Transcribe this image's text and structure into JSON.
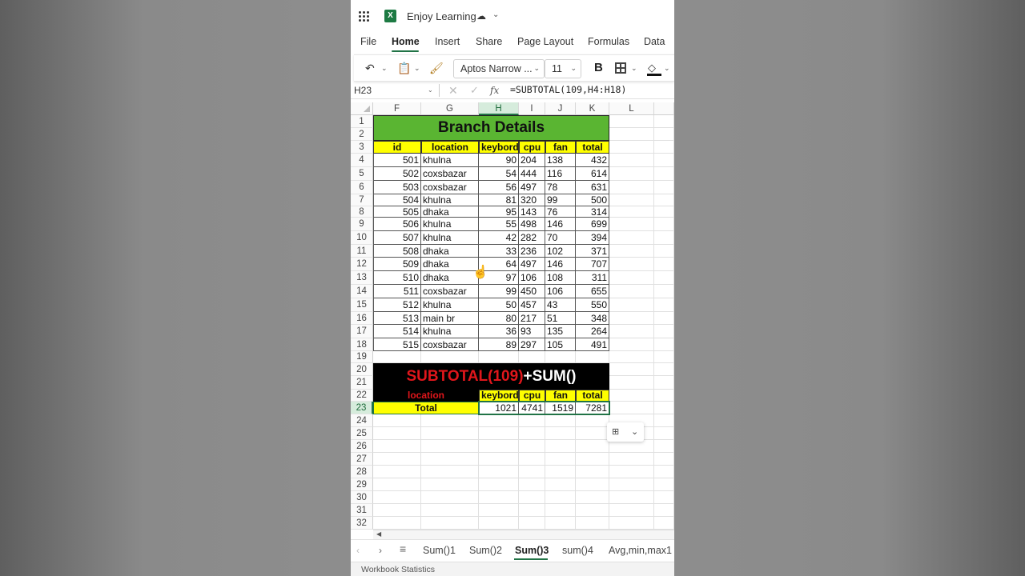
{
  "app": {
    "title": "Enjoy Learning",
    "logo_letter": "X"
  },
  "menu": [
    "File",
    "Home",
    "Insert",
    "Share",
    "Page Layout",
    "Formulas",
    "Data"
  ],
  "ribbon": {
    "font_name": "Aptos Narrow ...",
    "font_size": "11",
    "bold": "B"
  },
  "formula_bar": {
    "cell_ref": "H23",
    "fx": "fx",
    "formula": "=SUBTOTAL(109,H4:H18)"
  },
  "columns": [
    "F",
    "G",
    "H",
    "I",
    "J",
    "K",
    "L"
  ],
  "rows": [
    "1",
    "2",
    "3",
    "4",
    "5",
    "6",
    "7",
    "8",
    "9",
    "10",
    "11",
    "12",
    "13",
    "14",
    "15",
    "16",
    "17",
    "18",
    "19",
    "20",
    "21",
    "22",
    "23",
    "24",
    "25",
    "26",
    "27",
    "28",
    "29",
    "30",
    "31",
    "32"
  ],
  "table": {
    "title": "Branch Details",
    "headers": [
      "id",
      "location",
      "keybord",
      "cpu",
      "fan",
      "total"
    ],
    "rows": [
      [
        "501",
        "khulna",
        "90",
        "204",
        "138",
        "432"
      ],
      [
        "502",
        "coxsbazar",
        "54",
        "444",
        "116",
        "614"
      ],
      [
        "503",
        "coxsbazar",
        "56",
        "497",
        "78",
        "631"
      ],
      [
        "504",
        "khulna",
        "81",
        "320",
        "99",
        "500"
      ],
      [
        "505",
        "dhaka",
        "95",
        "143",
        "76",
        "314"
      ],
      [
        "506",
        "khulna",
        "55",
        "498",
        "146",
        "699"
      ],
      [
        "507",
        "khulna",
        "42",
        "282",
        "70",
        "394"
      ],
      [
        "508",
        "dhaka",
        "33",
        "236",
        "102",
        "371"
      ],
      [
        "509",
        "dhaka",
        "64",
        "497",
        "146",
        "707"
      ],
      [
        "510",
        "dhaka",
        "97",
        "106",
        "108",
        "311"
      ],
      [
        "511",
        "coxsbazar",
        "99",
        "450",
        "106",
        "655"
      ],
      [
        "512",
        "khulna",
        "50",
        "457",
        "43",
        "550"
      ],
      [
        "513",
        "main br",
        "80",
        "217",
        "51",
        "348"
      ],
      [
        "514",
        "khulna",
        "36",
        "93",
        "135",
        "264"
      ],
      [
        "515",
        "coxsbazar",
        "89",
        "297",
        "105",
        "491"
      ]
    ]
  },
  "summary": {
    "banner_red": "SUBTOTAL(109)",
    "banner_white": "+SUM()",
    "location_label": "location",
    "headers": [
      "keybord",
      "cpu",
      "fan",
      "total"
    ],
    "total_label": "Total",
    "values": [
      "1021",
      "4741",
      "1519",
      "7281"
    ]
  },
  "sheets": [
    "Sum()1",
    "Sum()2",
    "Sum()3",
    "sum()4",
    "Avg,min,max1"
  ],
  "active_sheet": "Sum()3",
  "status": "Workbook Statistics",
  "colors": {
    "accent": "#217346",
    "green_banner": "#5ab532",
    "yellow": "#ffff00",
    "red": "#e0161b"
  }
}
